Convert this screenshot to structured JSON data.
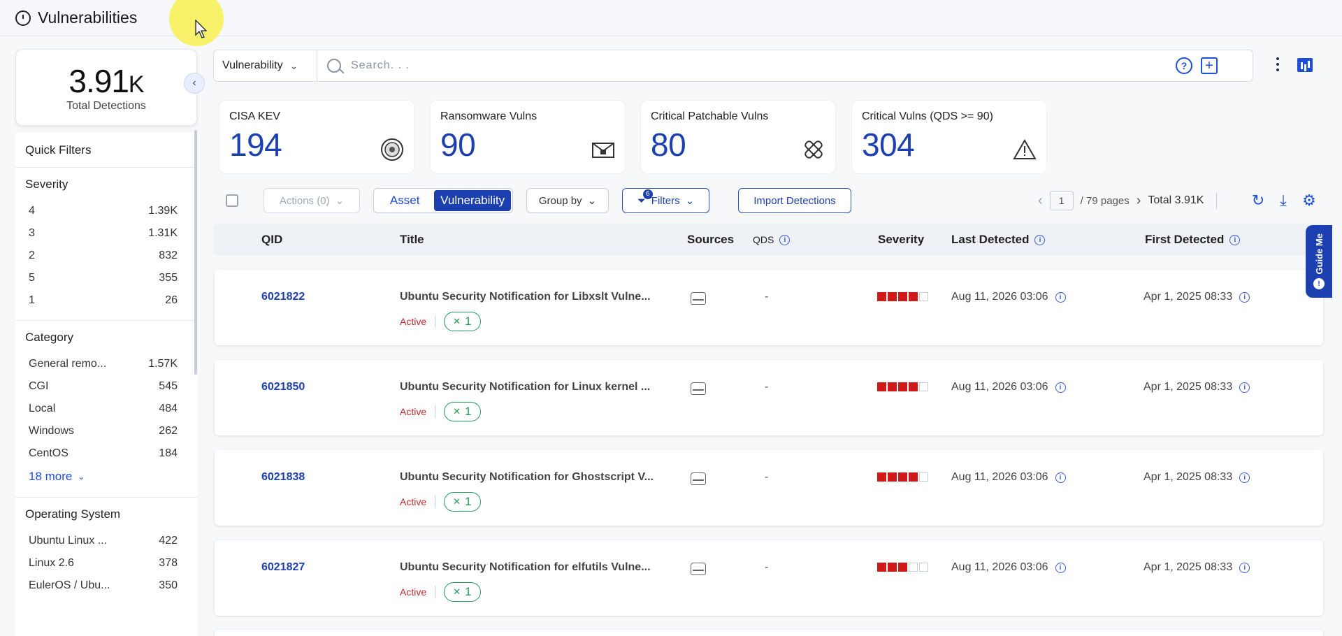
{
  "header": {
    "title": "Vulnerabilities"
  },
  "summary": {
    "total_value": "3.91",
    "total_suffix": "K",
    "total_label": "Total Detections"
  },
  "filters": {
    "title": "Quick Filters",
    "severity": {
      "title": "Severity",
      "items": [
        {
          "label": "4",
          "count": "1.39K"
        },
        {
          "label": "3",
          "count": "1.31K"
        },
        {
          "label": "2",
          "count": "832"
        },
        {
          "label": "5",
          "count": "355"
        },
        {
          "label": "1",
          "count": "26"
        }
      ]
    },
    "category": {
      "title": "Category",
      "items": [
        {
          "label": "General remo...",
          "count": "1.57K"
        },
        {
          "label": "CGI",
          "count": "545"
        },
        {
          "label": "Local",
          "count": "484"
        },
        {
          "label": "Windows",
          "count": "262"
        },
        {
          "label": "CentOS",
          "count": "184"
        }
      ],
      "more": "18 more"
    },
    "os": {
      "title": "Operating System",
      "items": [
        {
          "label": "Ubuntu Linux ...",
          "count": "422"
        },
        {
          "label": "Linux 2.6",
          "count": "378"
        },
        {
          "label": "EulerOS / Ubu...",
          "count": "350"
        }
      ]
    }
  },
  "search": {
    "type": "Vulnerability",
    "placeholder": "Search. . ."
  },
  "stats": [
    {
      "label": "CISA KEV",
      "value": "194",
      "icon": "seal-icon"
    },
    {
      "label": "Ransomware Vulns",
      "value": "90",
      "icon": "envelope-lock-icon"
    },
    {
      "label": "Critical Patchable Vulns",
      "value": "80",
      "icon": "bandage-icon"
    },
    {
      "label": "Critical Vulns (QDS >= 90)",
      "value": "304",
      "icon": "warning-icon"
    }
  ],
  "toolbar": {
    "actions": "Actions (0)",
    "seg_asset": "Asset",
    "seg_vuln": "Vulnerability",
    "group_by": "Group by",
    "filters": "Filters",
    "filters_count": "6",
    "import": "Import Detections",
    "page": "1",
    "pages": "/   79 pages",
    "total": "Total 3.91K"
  },
  "table": {
    "columns": {
      "qid": "QID",
      "title": "Title",
      "sources": "Sources",
      "qds": "QDS",
      "severity": "Severity",
      "last": "Last Detected",
      "first": "First Detected"
    },
    "rows": [
      {
        "qid": "6021822",
        "title": "Ubuntu Security Notification for Libxslt Vulne...",
        "status": "Active",
        "patches": "1",
        "qds": "-",
        "severity": 4,
        "last": "Aug 11, 2026 03:06",
        "first": "Apr 1, 2025 08:33"
      },
      {
        "qid": "6021850",
        "title": "Ubuntu Security Notification for Linux kernel ...",
        "status": "Active",
        "patches": "1",
        "qds": "-",
        "severity": 4,
        "last": "Aug 11, 2026 03:06",
        "first": "Apr 1, 2025 08:33"
      },
      {
        "qid": "6021838",
        "title": "Ubuntu Security Notification for Ghostscript V...",
        "status": "Active",
        "patches": "1",
        "qds": "-",
        "severity": 4,
        "last": "Aug 11, 2026 03:06",
        "first": "Apr 1, 2025 08:33"
      },
      {
        "qid": "6021827",
        "title": "Ubuntu Security Notification for elfutils Vulne...",
        "status": "Active",
        "patches": "1",
        "qds": "-",
        "severity": 3,
        "last": "Aug 11, 2026 03:06",
        "first": "Apr 1, 2025 08:33"
      }
    ]
  },
  "guide": {
    "label": "Guide Me"
  }
}
